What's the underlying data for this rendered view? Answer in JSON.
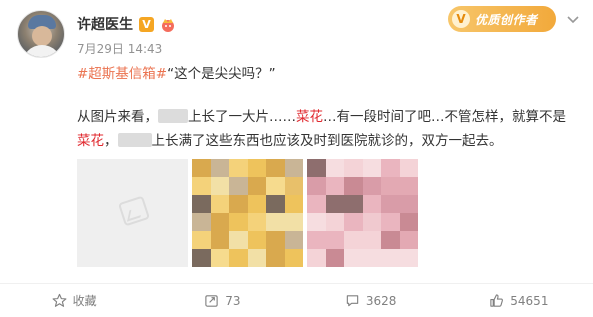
{
  "post": {
    "author": "许超医生",
    "verified_badge": "V",
    "time": "7月29日 14:43",
    "tag": "#超斯基信箱#",
    "quote": "“这个是尖尖吗？”",
    "sticker": {
      "letter": "V",
      "text": "优质创作者"
    },
    "body_line1_a": "从图片来看，",
    "body_line1_b": "上长了一大片……",
    "body_line1_red": "菜花",
    "body_line1_c": "…有一段时间了吧…不管怎样，就算不是",
    "body_line2_red": "菜花",
    "body_line2_a": "，",
    "body_line2_b": "上长满了这些东西也应该及时到医院就诊的，双方一起去。"
  },
  "actions": {
    "favorite_label": "收藏",
    "repost_count": "73",
    "comment_count": "3628",
    "like_count": "54651"
  },
  "colors": {
    "tag": "#eb7350",
    "highlight": "#e0282e",
    "muted": "#939393",
    "accent": "#f5a623"
  },
  "icons": [
    "chevron-down-icon",
    "star-icon",
    "repost-icon",
    "comment-icon",
    "like-icon",
    "crown-icon",
    "image-placeholder-icon"
  ]
}
